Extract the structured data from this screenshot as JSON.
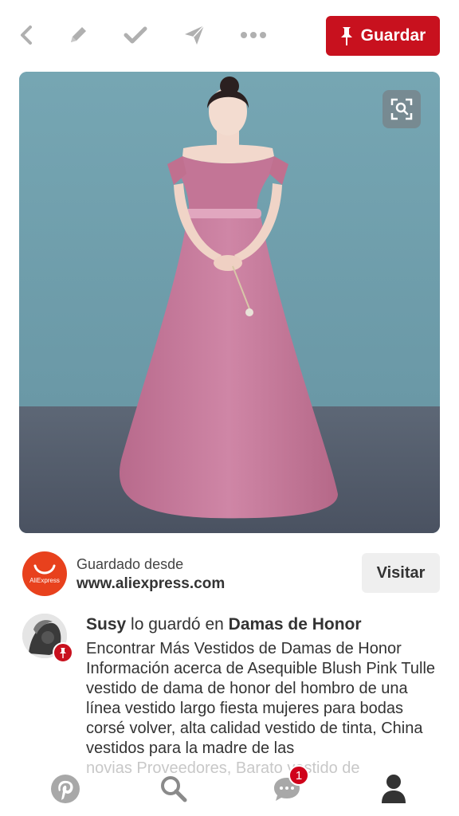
{
  "toolbar": {
    "save_label": "Guardar",
    "icons": [
      "back-icon",
      "edit-icon",
      "check-icon",
      "send-icon",
      "more-icon"
    ]
  },
  "pin_image": {
    "alt": "Vestido largo de dama de honor rosa",
    "lens_icon": "visual-search-icon"
  },
  "source": {
    "logo_text": "AliExpress",
    "saved_from": "Guardado desde",
    "domain": "www.aliexpress.com",
    "visit_label": "Visitar"
  },
  "activity": {
    "user": "Susy",
    "action": "lo guardó en",
    "board": "Damas de Honor",
    "description": "Encontrar Más Vestidos de Damas de Honor Información acerca de Asequible Blush Pink Tulle vestido de dama de honor del hombro de una línea vestido largo fiesta mujeres para bodas corsé volver, alta calidad vestido de tinta, China vestidos para la madre de las",
    "overflow_line": "novias Proveedores, Barato vestido de"
  },
  "bottom_nav": {
    "items": [
      "pinterest-home-icon",
      "search-icon",
      "messages-icon",
      "profile-icon"
    ],
    "messages_badge": "1"
  },
  "colors": {
    "brand_red": "#c8111e",
    "aliexpress_orange": "#e8411d",
    "image_background": "#6f9fad"
  }
}
